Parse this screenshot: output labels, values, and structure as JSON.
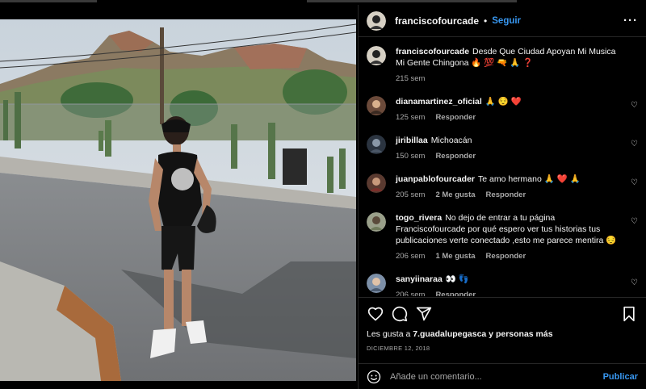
{
  "header": {
    "username": "franciscofourcade",
    "follow_label": "Seguir",
    "more_label": "···"
  },
  "caption": {
    "username": "franciscofourcade",
    "text": "Desde Que Ciudad Apoyan Mi Musica Mi Gente Chingona 🔥 💯 🔫 🙏 ❓",
    "time": "215 sem"
  },
  "comments": [
    {
      "username": "dianamartinez_oficial",
      "text": "🙏 😌 ❤️",
      "time": "125 sem",
      "likes": "",
      "reply": "Responder"
    },
    {
      "username": "jiribillaa",
      "text": "Michoacán",
      "time": "150 sem",
      "likes": "",
      "reply": "Responder"
    },
    {
      "username": "juanpablofourcader",
      "text": "Te amo hermano 🙏 ❤️ 🙏",
      "time": "205 sem",
      "likes": "2 Me gusta",
      "reply": "Responder"
    },
    {
      "username": "togo_rivera",
      "text": "No dejo de entrar a tu página Franciscofourcade por qué espero ver tus historias tus publicaciones verte conectado ,esto me parece mentira 😔",
      "time": "206 sem",
      "likes": "1 Me gusta",
      "reply": "Responder"
    },
    {
      "username": "sanyiinaraa",
      "text": "👀 👣",
      "time": "206 sem",
      "likes": "",
      "reply": "Responder"
    }
  ],
  "likes": {
    "prefix": "Les gusta a ",
    "user": "7.guadalupegasca",
    "suffix": " y personas más"
  },
  "date": "DICIEMBRE 12, 2018",
  "add_comment": {
    "placeholder": "Añade un comentario...",
    "post_label": "Publicar"
  },
  "colors": {
    "accent": "#3897f0",
    "background": "#000000",
    "muted": "#a8a8a8",
    "heart": "#ed4956"
  },
  "icons": [
    "heart-icon",
    "comment-icon",
    "share-icon",
    "bookmark-icon",
    "emoji-icon",
    "more-options-icon"
  ]
}
